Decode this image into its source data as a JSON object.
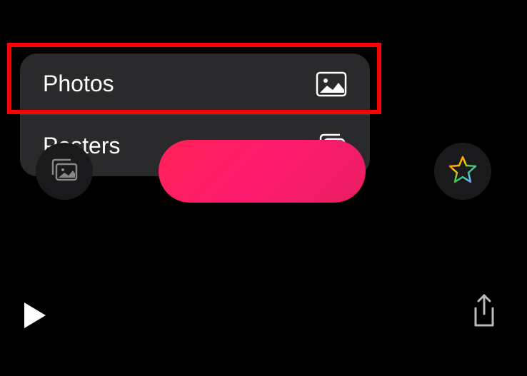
{
  "menu": {
    "items": [
      {
        "label": "Photos",
        "icon": "photo-icon"
      },
      {
        "label": "Posters",
        "icon": "posters-icon"
      }
    ]
  },
  "toolbar": {
    "gallery": "gallery",
    "pill": "",
    "star": "star"
  },
  "controls": {
    "play": "play",
    "share": "share"
  }
}
